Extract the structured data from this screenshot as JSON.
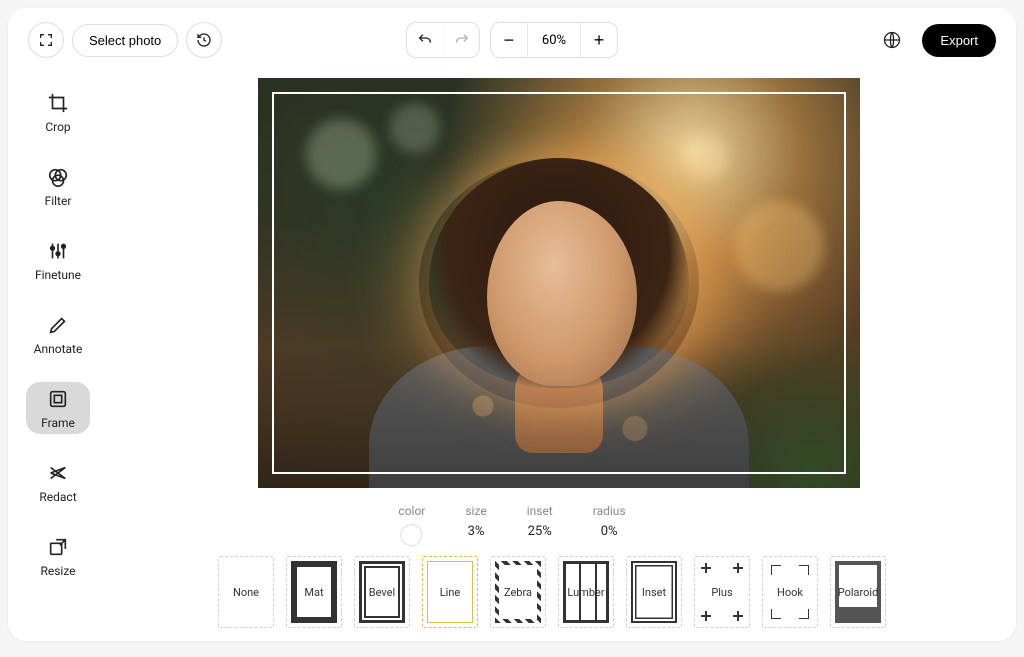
{
  "topbar": {
    "select_photo": "Select photo",
    "zoom": "60%",
    "export": "Export"
  },
  "tools": [
    {
      "id": "crop",
      "label": "Crop"
    },
    {
      "id": "filter",
      "label": "Filter"
    },
    {
      "id": "finetune",
      "label": "Finetune"
    },
    {
      "id": "annotate",
      "label": "Annotate"
    },
    {
      "id": "frame",
      "label": "Frame"
    },
    {
      "id": "redact",
      "label": "Redact"
    },
    {
      "id": "resize",
      "label": "Resize"
    }
  ],
  "active_tool": "frame",
  "frame_params": {
    "color_label": "color",
    "color_value": "#ffffff",
    "size_label": "size",
    "size_value": "3%",
    "inset_label": "inset",
    "inset_value": "25%",
    "radius_label": "radius",
    "radius_value": "0%"
  },
  "frame_styles": [
    {
      "id": "none",
      "label": "None"
    },
    {
      "id": "mat",
      "label": "Mat"
    },
    {
      "id": "bevel",
      "label": "Bevel"
    },
    {
      "id": "line",
      "label": "Line"
    },
    {
      "id": "zebra",
      "label": "Zebra"
    },
    {
      "id": "lumber",
      "label": "Lumber"
    },
    {
      "id": "inset",
      "label": "Inset"
    },
    {
      "id": "plus",
      "label": "Plus"
    },
    {
      "id": "hook",
      "label": "Hook"
    },
    {
      "id": "polaroid",
      "label": "Polaroid"
    }
  ],
  "selected_frame_style": "line"
}
